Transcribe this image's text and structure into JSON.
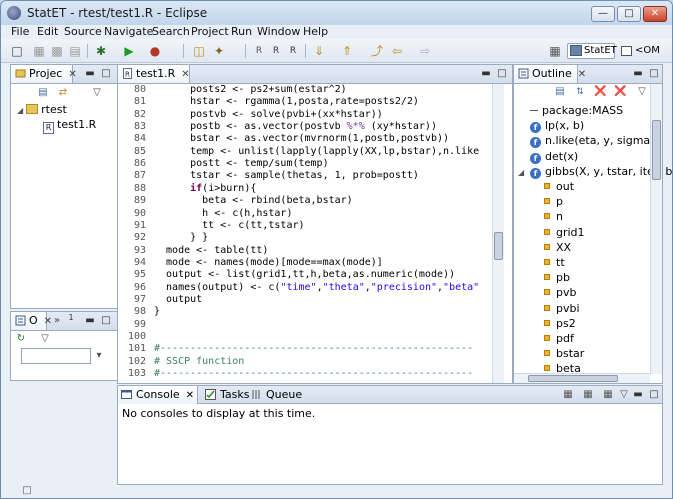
{
  "window": {
    "title": "StatET - rtest/test1.R - Eclipse"
  },
  "menu": [
    "File",
    "Edit",
    "Source",
    "Navigate",
    "Search",
    "Project",
    "Run",
    "Window",
    "Help"
  ],
  "perspectives": {
    "active": "StatET",
    "other": "<OM"
  },
  "project": {
    "tab_label": "Projec",
    "root": "rtest",
    "file": "test1.R"
  },
  "small_outline": {
    "tab_label": "O",
    "tab2": "1"
  },
  "editor": {
    "tab_label": "test1.R",
    "lines": [
      {
        "n": "80",
        "code": "      posts2 <- ps2+sum(estar^2)"
      },
      {
        "n": "81",
        "code": "      hstar <- rgamma(1,posta,rate=posts2/2)"
      },
      {
        "n": "82",
        "code": "      postvb <- solve(pvbi+(xx*hstar))"
      },
      {
        "n": "83",
        "code": "      postb <- as.vector(postvb %*% (xy*hstar))"
      },
      {
        "n": "84",
        "code": "      bstar <- as.vector(mvrnorm(1,postb,postvb))"
      },
      {
        "n": "85",
        "code": "      temp <- unlist(lapply(lapply(XX,lp,bstar),n.like"
      },
      {
        "n": "86",
        "code": "      postt <- temp/sum(temp)"
      },
      {
        "n": "87",
        "code": "      tstar <- sample(thetas, 1, prob=postt)"
      },
      {
        "n": "88",
        "code": "      if(i>burn){"
      },
      {
        "n": "89",
        "code": "        beta <- rbind(beta,bstar)"
      },
      {
        "n": "90",
        "code": "        h <- c(h,hstar)"
      },
      {
        "n": "91",
        "code": "        tt <- c(tt,tstar)"
      },
      {
        "n": "92",
        "code": "      } }"
      },
      {
        "n": "93",
        "code": "  mode <- table(tt)"
      },
      {
        "n": "94",
        "code": "  mode <- names(mode)[mode==max(mode)]"
      },
      {
        "n": "95",
        "code": "  output <- list(grid1,tt,h,beta,as.numeric(mode))"
      },
      {
        "n": "96",
        "code": "  names(output) <- c(\"time\",\"theta\",\"precision\",\"beta\""
      },
      {
        "n": "97",
        "code": "  output"
      },
      {
        "n": "98",
        "code": "}"
      },
      {
        "n": "99",
        "code": ""
      },
      {
        "n": "100",
        "code": ""
      },
      {
        "n": "101",
        "code": "#----------------------------------------------------"
      },
      {
        "n": "102",
        "code": "# SSCP function"
      },
      {
        "n": "103",
        "code": "#----------------------------------------------------"
      }
    ]
  },
  "outline": {
    "tab_label": "Outline",
    "items": [
      {
        "kind": "pkg",
        "label": "package:MASS"
      },
      {
        "kind": "fn",
        "label": "lp(x, b)"
      },
      {
        "kind": "fn",
        "label": "n.like(eta, y, sigma)"
      },
      {
        "kind": "fn",
        "label": "det(x)"
      },
      {
        "kind": "fn",
        "label": "gibbs(X, y, tstar, iter, bu"
      },
      {
        "kind": "var",
        "label": "out"
      },
      {
        "kind": "var",
        "label": "p"
      },
      {
        "kind": "var",
        "label": "n"
      },
      {
        "kind": "var",
        "label": "grid1"
      },
      {
        "kind": "var",
        "label": "XX"
      },
      {
        "kind": "var",
        "label": "tt"
      },
      {
        "kind": "var",
        "label": "pb"
      },
      {
        "kind": "var",
        "label": "pvb"
      },
      {
        "kind": "var",
        "label": "pvbi"
      },
      {
        "kind": "var",
        "label": "ps2"
      },
      {
        "kind": "var",
        "label": "pdf"
      },
      {
        "kind": "var",
        "label": "bstar"
      },
      {
        "kind": "var",
        "label": "beta"
      }
    ]
  },
  "console": {
    "tabs": [
      "Console",
      "Tasks",
      "Queue"
    ],
    "message": "No consoles to display at this time."
  },
  "colors": {
    "keyword": "#7f0055",
    "string": "#2a00ff",
    "comment": "#3f7f5f"
  }
}
